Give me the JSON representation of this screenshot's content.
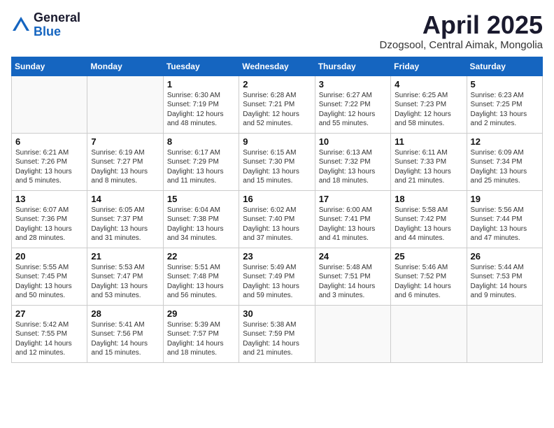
{
  "logo": {
    "general": "General",
    "blue": "Blue"
  },
  "title": {
    "month": "April 2025",
    "location": "Dzogsool, Central Aimak, Mongolia"
  },
  "headers": [
    "Sunday",
    "Monday",
    "Tuesday",
    "Wednesday",
    "Thursday",
    "Friday",
    "Saturday"
  ],
  "weeks": [
    [
      {
        "day": "",
        "info": ""
      },
      {
        "day": "",
        "info": ""
      },
      {
        "day": "1",
        "info": "Sunrise: 6:30 AM\nSunset: 7:19 PM\nDaylight: 12 hours and 48 minutes."
      },
      {
        "day": "2",
        "info": "Sunrise: 6:28 AM\nSunset: 7:21 PM\nDaylight: 12 hours and 52 minutes."
      },
      {
        "day": "3",
        "info": "Sunrise: 6:27 AM\nSunset: 7:22 PM\nDaylight: 12 hours and 55 minutes."
      },
      {
        "day": "4",
        "info": "Sunrise: 6:25 AM\nSunset: 7:23 PM\nDaylight: 12 hours and 58 minutes."
      },
      {
        "day": "5",
        "info": "Sunrise: 6:23 AM\nSunset: 7:25 PM\nDaylight: 13 hours and 2 minutes."
      }
    ],
    [
      {
        "day": "6",
        "info": "Sunrise: 6:21 AM\nSunset: 7:26 PM\nDaylight: 13 hours and 5 minutes."
      },
      {
        "day": "7",
        "info": "Sunrise: 6:19 AM\nSunset: 7:27 PM\nDaylight: 13 hours and 8 minutes."
      },
      {
        "day": "8",
        "info": "Sunrise: 6:17 AM\nSunset: 7:29 PM\nDaylight: 13 hours and 11 minutes."
      },
      {
        "day": "9",
        "info": "Sunrise: 6:15 AM\nSunset: 7:30 PM\nDaylight: 13 hours and 15 minutes."
      },
      {
        "day": "10",
        "info": "Sunrise: 6:13 AM\nSunset: 7:32 PM\nDaylight: 13 hours and 18 minutes."
      },
      {
        "day": "11",
        "info": "Sunrise: 6:11 AM\nSunset: 7:33 PM\nDaylight: 13 hours and 21 minutes."
      },
      {
        "day": "12",
        "info": "Sunrise: 6:09 AM\nSunset: 7:34 PM\nDaylight: 13 hours and 25 minutes."
      }
    ],
    [
      {
        "day": "13",
        "info": "Sunrise: 6:07 AM\nSunset: 7:36 PM\nDaylight: 13 hours and 28 minutes."
      },
      {
        "day": "14",
        "info": "Sunrise: 6:05 AM\nSunset: 7:37 PM\nDaylight: 13 hours and 31 minutes."
      },
      {
        "day": "15",
        "info": "Sunrise: 6:04 AM\nSunset: 7:38 PM\nDaylight: 13 hours and 34 minutes."
      },
      {
        "day": "16",
        "info": "Sunrise: 6:02 AM\nSunset: 7:40 PM\nDaylight: 13 hours and 37 minutes."
      },
      {
        "day": "17",
        "info": "Sunrise: 6:00 AM\nSunset: 7:41 PM\nDaylight: 13 hours and 41 minutes."
      },
      {
        "day": "18",
        "info": "Sunrise: 5:58 AM\nSunset: 7:42 PM\nDaylight: 13 hours and 44 minutes."
      },
      {
        "day": "19",
        "info": "Sunrise: 5:56 AM\nSunset: 7:44 PM\nDaylight: 13 hours and 47 minutes."
      }
    ],
    [
      {
        "day": "20",
        "info": "Sunrise: 5:55 AM\nSunset: 7:45 PM\nDaylight: 13 hours and 50 minutes."
      },
      {
        "day": "21",
        "info": "Sunrise: 5:53 AM\nSunset: 7:47 PM\nDaylight: 13 hours and 53 minutes."
      },
      {
        "day": "22",
        "info": "Sunrise: 5:51 AM\nSunset: 7:48 PM\nDaylight: 13 hours and 56 minutes."
      },
      {
        "day": "23",
        "info": "Sunrise: 5:49 AM\nSunset: 7:49 PM\nDaylight: 13 hours and 59 minutes."
      },
      {
        "day": "24",
        "info": "Sunrise: 5:48 AM\nSunset: 7:51 PM\nDaylight: 14 hours and 3 minutes."
      },
      {
        "day": "25",
        "info": "Sunrise: 5:46 AM\nSunset: 7:52 PM\nDaylight: 14 hours and 6 minutes."
      },
      {
        "day": "26",
        "info": "Sunrise: 5:44 AM\nSunset: 7:53 PM\nDaylight: 14 hours and 9 minutes."
      }
    ],
    [
      {
        "day": "27",
        "info": "Sunrise: 5:42 AM\nSunset: 7:55 PM\nDaylight: 14 hours and 12 minutes."
      },
      {
        "day": "28",
        "info": "Sunrise: 5:41 AM\nSunset: 7:56 PM\nDaylight: 14 hours and 15 minutes."
      },
      {
        "day": "29",
        "info": "Sunrise: 5:39 AM\nSunset: 7:57 PM\nDaylight: 14 hours and 18 minutes."
      },
      {
        "day": "30",
        "info": "Sunrise: 5:38 AM\nSunset: 7:59 PM\nDaylight: 14 hours and 21 minutes."
      },
      {
        "day": "",
        "info": ""
      },
      {
        "day": "",
        "info": ""
      },
      {
        "day": "",
        "info": ""
      }
    ]
  ]
}
